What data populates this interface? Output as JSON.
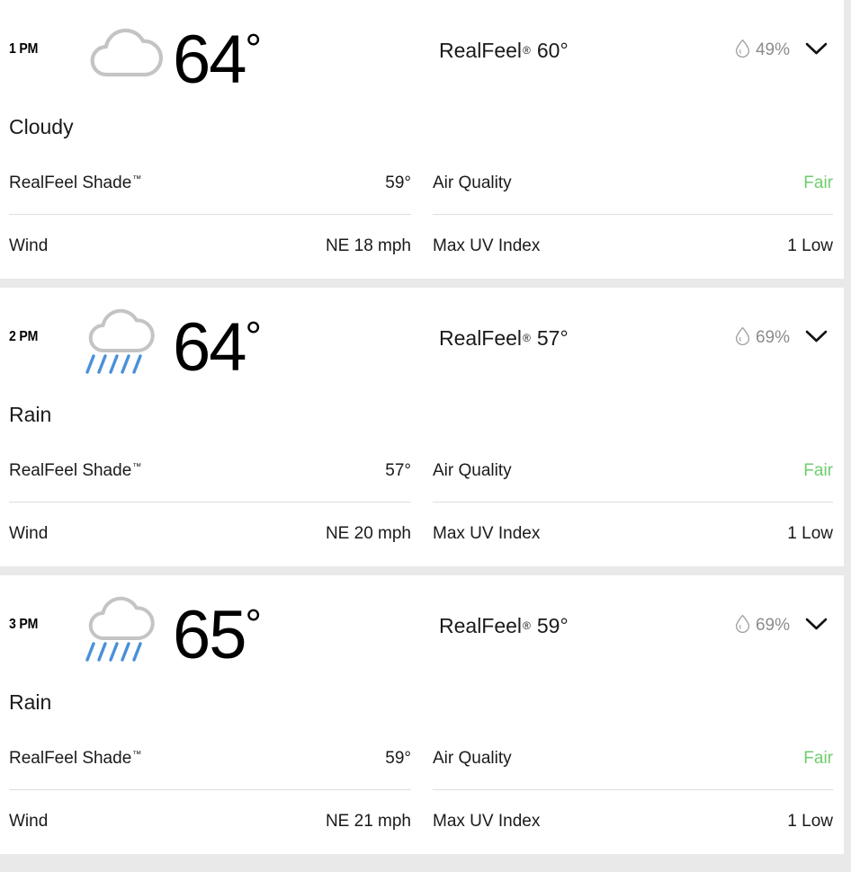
{
  "theme": {
    "page_background": "#e9e9e9",
    "card_background": "#ffffff",
    "text_color": "#1a1a1a",
    "muted_color": "#8c8c8c",
    "divider_color": "#dedede",
    "good_color": "#6ece6e",
    "cloud_color": "#c4c4c4",
    "rain_color": "#4a90d9"
  },
  "labels": {
    "realfeel": "RealFeel",
    "realfeel_reg": "®",
    "realfeel_shade": "RealFeel Shade",
    "trademark": "™",
    "wind": "Wind",
    "air_quality": "Air Quality",
    "max_uv_index": "Max UV Index",
    "degree": "°"
  },
  "icons": {
    "precip_drop": "water-drop-icon",
    "expand": "chevron-down-icon",
    "cloudy": "cloud-icon",
    "rain": "cloud-rain-icon"
  },
  "hours": [
    {
      "time": "1 PM",
      "icon": "cloudy",
      "temperature": "64°",
      "temp_value": "64",
      "realfeel": "60°",
      "precip_chance": "49%",
      "phrase": "Cloudy",
      "realfeel_shade": "59°",
      "wind": "NE 18 mph",
      "air_quality": "Fair",
      "max_uv_index": "1 Low"
    },
    {
      "time": "2 PM",
      "icon": "rain",
      "temperature": "64°",
      "temp_value": "64",
      "realfeel": "57°",
      "precip_chance": "69%",
      "phrase": "Rain",
      "realfeel_shade": "57°",
      "wind": "NE 20 mph",
      "air_quality": "Fair",
      "max_uv_index": "1 Low"
    },
    {
      "time": "3 PM",
      "icon": "rain",
      "temperature": "65°",
      "temp_value": "65",
      "realfeel": "59°",
      "precip_chance": "69%",
      "phrase": "Rain",
      "realfeel_shade": "59°",
      "wind": "NE 21 mph",
      "air_quality": "Fair",
      "max_uv_index": "1 Low"
    }
  ]
}
